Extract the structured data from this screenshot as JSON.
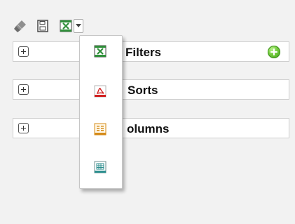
{
  "toolbar": {
    "buttons": [
      {
        "icon": "brush-icon"
      },
      {
        "icon": "save-icon"
      },
      {
        "icon": "excel-export-icon"
      }
    ],
    "export_caret_icon": "chevron-down-icon"
  },
  "panels": [
    {
      "label": "Filters",
      "expand_icon": "plus-square-icon",
      "add_icon": "add-icon"
    },
    {
      "label": "Sorts",
      "expand_icon": "plus-square-icon"
    },
    {
      "label": "olumns",
      "expand_icon": "plus-square-icon"
    }
  ],
  "dropdown": {
    "items": [
      {
        "icon": "excel-icon"
      },
      {
        "icon": "pdf-icon"
      },
      {
        "icon": "html-icon"
      },
      {
        "icon": "csv-icon"
      }
    ]
  },
  "colors": {
    "background": "#f2f2f2",
    "panel_border": "#cfcfcf",
    "excel_green": "#2f8f3a",
    "pdf_red": "#d01f1f",
    "html_orange": "#d58b19",
    "csv_teal": "#2b8e8e",
    "add_green": "#58b82b"
  }
}
